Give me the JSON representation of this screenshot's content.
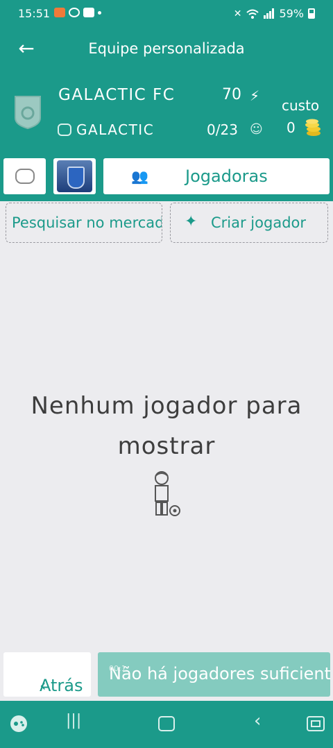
{
  "status_bar": {
    "time": "15:51",
    "battery": "59%"
  },
  "app_bar": {
    "title": "Equipe personalizada"
  },
  "team": {
    "name": "GALACTIC FC",
    "rating": "70",
    "league": "GALACTIC",
    "player_count": "0/23",
    "cost_label": "custo",
    "cost_value": "0"
  },
  "tiles": {
    "players_label": "Jogadoras"
  },
  "actions": {
    "search_label": "Pesquisar no mercado",
    "create_label": "Criar jogador"
  },
  "empty_state": {
    "line1": "Nenhum jogador para",
    "line2": "mostrar"
  },
  "footer": {
    "back_label": "Atrás",
    "next_label": "Não há jogadores suficientes",
    "timer": "00:1"
  },
  "colors": {
    "primary": "#1b9a8a",
    "disabled": "#84cbbf",
    "background": "#ececef"
  }
}
